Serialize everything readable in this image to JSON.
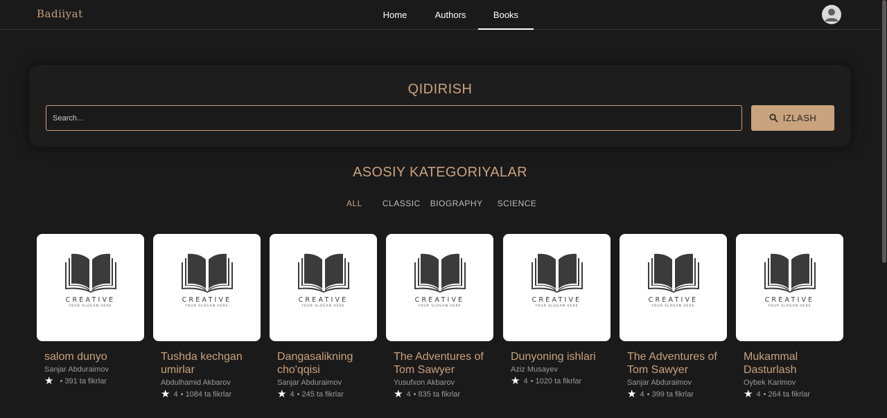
{
  "header": {
    "logo": "Badiiyat",
    "nav": [
      {
        "label": "Home"
      },
      {
        "label": "Authors"
      },
      {
        "label": "Books",
        "active": true
      }
    ]
  },
  "search": {
    "title": "QIDIRISH",
    "placeholder": "Search...",
    "button_label": "IZLASH"
  },
  "categories": {
    "title": "ASOSIY KATEGORIYALAR",
    "items": [
      "ALL",
      "CLASSIC",
      "BIOGRAPHY",
      "SCIENCE"
    ],
    "active": "ALL"
  },
  "image_text": {
    "brand": "CREATIVE",
    "slogan": "YOUR SLOGAN HERE"
  },
  "books": [
    {
      "title": "salom dunyo",
      "author": "Sanjar Abduraimov",
      "rating": "",
      "meta": "• 391 ta fikrlar"
    },
    {
      "title": "Tushda kechgan umirlar",
      "author": "Abdulhamid Akbarov",
      "rating": "4",
      "meta": "• 1084 ta fikrlar"
    },
    {
      "title": "Dangasalikning cho'qqisi",
      "author": "Sanjar Abduraimov",
      "rating": "4",
      "meta": "• 245 ta fikrlar"
    },
    {
      "title": "The Adventures of Tom Sawyer",
      "author": "Yusufxon Akbarov",
      "rating": "4",
      "meta": "• 835 ta fikrlar"
    },
    {
      "title": "Dunyoning ishlari",
      "author": "Aziz Musayev",
      "rating": "4",
      "meta": "• 1020 ta fikrlar"
    },
    {
      "title": "The Adventures of Tom Sawyer",
      "author": "Sanjar Abduraimov",
      "rating": "4",
      "meta": "• 399 ta fikrlar"
    },
    {
      "title": "Mukammal Dasturlash",
      "author": "Oybek Karimov",
      "rating": "4",
      "meta": "• 264 ta fikrlar"
    }
  ],
  "colors": {
    "accent": "#c9a27e",
    "background": "#1b1a1a",
    "muted_text": "#9b9b9b"
  },
  "icons": {
    "search": "search-icon",
    "avatar": "user-icon",
    "rating": "star-icon",
    "cover": "open-book-icon"
  }
}
